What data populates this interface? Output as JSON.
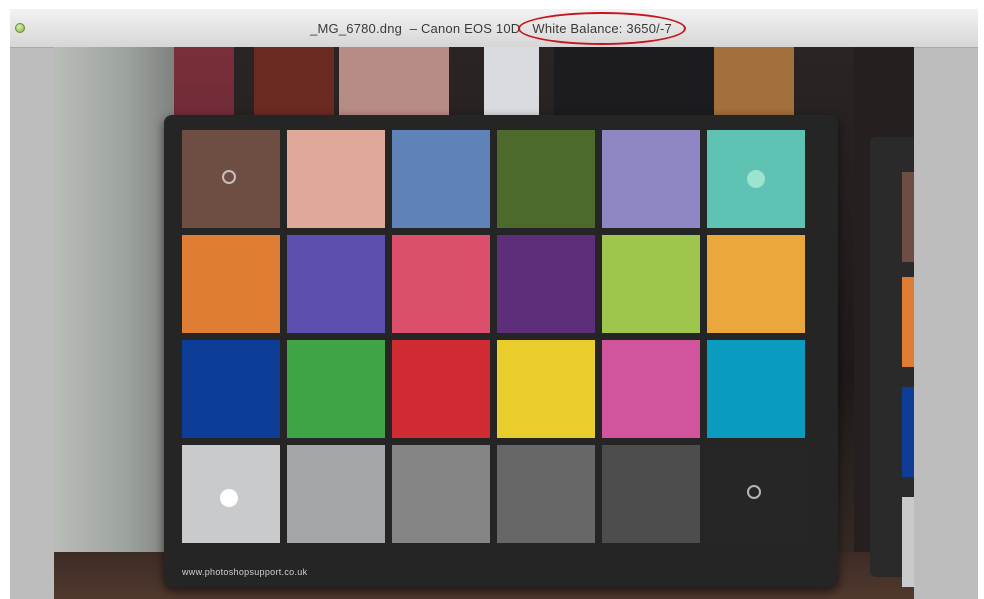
{
  "window": {
    "title_main": "_MG_6780.dng  – Canon EOS 10D",
    "title_wb": "White Balance: 3650/-7"
  },
  "checker": {
    "swatches": [
      {
        "color": "#6e4d42",
        "marker": "ring"
      },
      {
        "color": "#e0a898",
        "marker": ""
      },
      {
        "color": "#5f82b8",
        "marker": ""
      },
      {
        "color": "#4d6a2c",
        "marker": ""
      },
      {
        "color": "#8f86c4",
        "marker": ""
      },
      {
        "color": "#5fc3b4",
        "marker": "light"
      },
      {
        "color": "#e07d34",
        "marker": ""
      },
      {
        "color": "#5b50b0",
        "marker": ""
      },
      {
        "color": "#dc4f6c",
        "marker": ""
      },
      {
        "color": "#5f2e7a",
        "marker": ""
      },
      {
        "color": "#9ec64c",
        "marker": ""
      },
      {
        "color": "#eaa73b",
        "marker": ""
      },
      {
        "color": "#0e3d98",
        "marker": ""
      },
      {
        "color": "#3ea445",
        "marker": ""
      },
      {
        "color": "#d02b33",
        "marker": ""
      },
      {
        "color": "#e8cd2d",
        "marker": ""
      },
      {
        "color": "#d1549d",
        "marker": ""
      },
      {
        "color": "#0b9bbf",
        "marker": ""
      },
      {
        "color": "#c9cacc",
        "marker": "dot"
      },
      {
        "color": "#a4a5a6",
        "marker": ""
      },
      {
        "color": "#858585",
        "marker": ""
      },
      {
        "color": "#676767",
        "marker": ""
      },
      {
        "color": "#4d4d4d",
        "marker": ""
      },
      {
        "color": "#262626",
        "marker": "ring"
      }
    ],
    "url_text": "www.photoshopsupport.co.uk"
  },
  "side_card": {
    "patches": [
      "#6e4d42",
      "#e07d34",
      "#0e3d98",
      "#c9cacc"
    ]
  },
  "colors": {
    "annotation_circle": "#c8141d",
    "window_button": "#7fb03f"
  }
}
